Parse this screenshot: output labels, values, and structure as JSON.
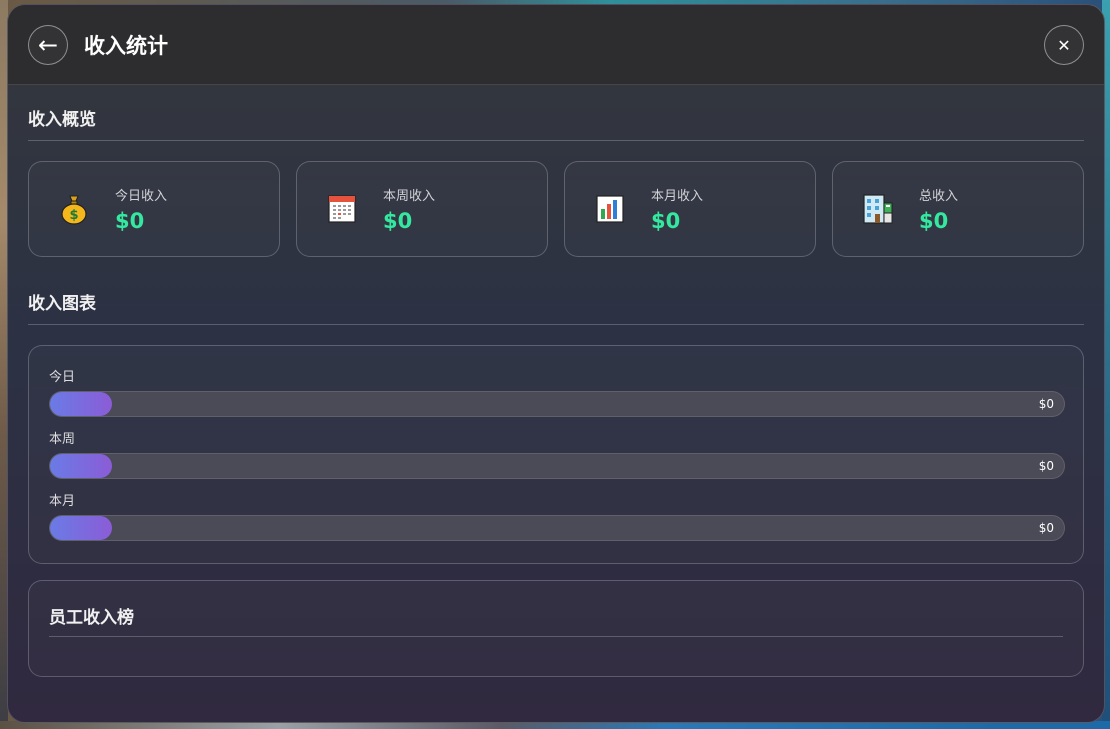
{
  "header": {
    "title": "收入统计",
    "back_icon": "←",
    "close_icon": "✕"
  },
  "overview": {
    "title": "收入概览",
    "cards": [
      {
        "label": "今日收入",
        "value": "$0",
        "icon": "money-bag-icon"
      },
      {
        "label": "本周收入",
        "value": "$0",
        "icon": "calendar-icon"
      },
      {
        "label": "本月收入",
        "value": "$0",
        "icon": "bar-chart-icon"
      },
      {
        "label": "总收入",
        "value": "$0",
        "icon": "building-icon"
      }
    ]
  },
  "chart": {
    "title": "收入图表",
    "accent_start": "#6a7be6",
    "accent_end": "#8b5cd6"
  },
  "chart_data": {
    "type": "bar",
    "categories": [
      "今日",
      "本周",
      "本月"
    ],
    "values": [
      0,
      0,
      0
    ],
    "value_labels": [
      "$0",
      "$0",
      "$0"
    ]
  },
  "ranking": {
    "title": "员工收入榜"
  },
  "colors": {
    "value_green": "#34e8a0"
  }
}
